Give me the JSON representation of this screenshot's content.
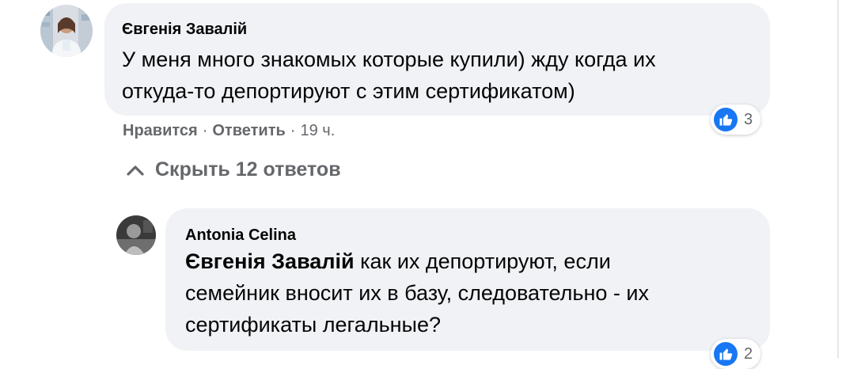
{
  "comment": {
    "author": "Євгенія Завалій",
    "text_line1": "У меня много знакомых которые купили) жду когда их",
    "text_line2": "откуда-то депортируют с этим сертификатом)",
    "reaction_count": "3",
    "like_label": "Нравится",
    "reply_label": "Ответить",
    "separator": "·",
    "time": "19 ч."
  },
  "replies_toggle": {
    "label": "Скрыть 12 ответов"
  },
  "reply": {
    "author": "Antonia Celina",
    "mention": "Євгенія Завалій",
    "text_line1_rest": " как их депортируют, если",
    "text_line2": "семейник вносит их в базу, следовательно - их",
    "text_line3": "сертификаты легальные?",
    "reaction_count": "2"
  },
  "colors": {
    "bubble": "#f0f2f5",
    "meta_text": "#65676b",
    "like_blue": "#1877f2"
  },
  "icons": [
    "avatar-photo",
    "like-icon",
    "chevron-up-icon"
  ]
}
